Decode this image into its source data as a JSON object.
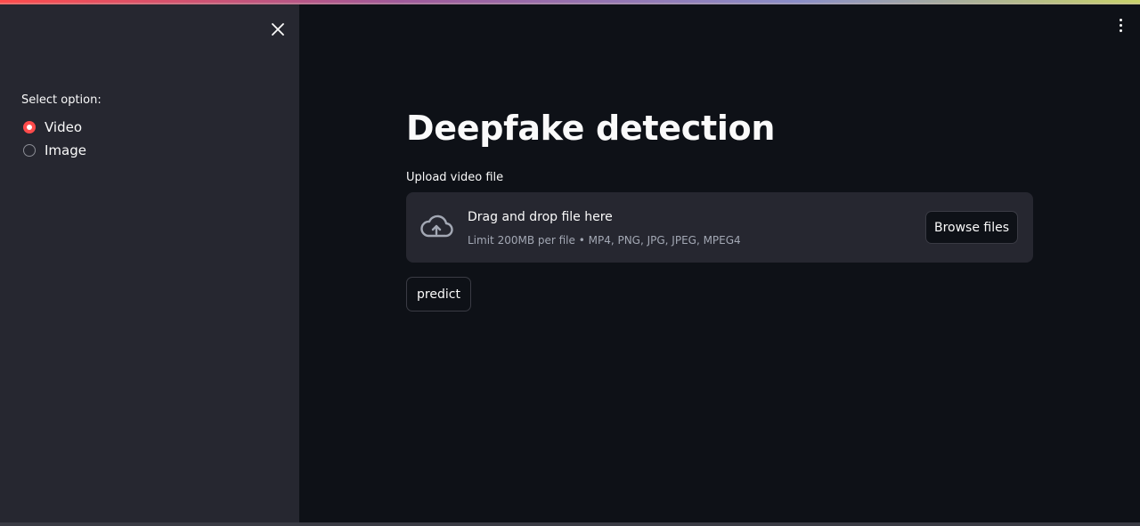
{
  "sidebar": {
    "select_label": "Select option:",
    "options": [
      {
        "label": "Video",
        "selected": true
      },
      {
        "label": "Image",
        "selected": false
      }
    ],
    "close_icon": "close-icon"
  },
  "main": {
    "title": "Deepfake detection",
    "uploader": {
      "label": "Upload video file",
      "drop_title": "Drag and drop file here",
      "drop_subtitle": "Limit 200MB per file • MP4, PNG, JPG, JPEG, MPEG4",
      "browse_label": "Browse files",
      "icon": "cloud-upload-icon"
    },
    "predict_label": "predict"
  },
  "header": {
    "menu_icon": "kebab-menu-icon"
  },
  "colors": {
    "accent": "#ff4b4b",
    "background": "#0e1117",
    "sidebar_bg": "#262730",
    "secondary_text": "#a3a8b4"
  }
}
